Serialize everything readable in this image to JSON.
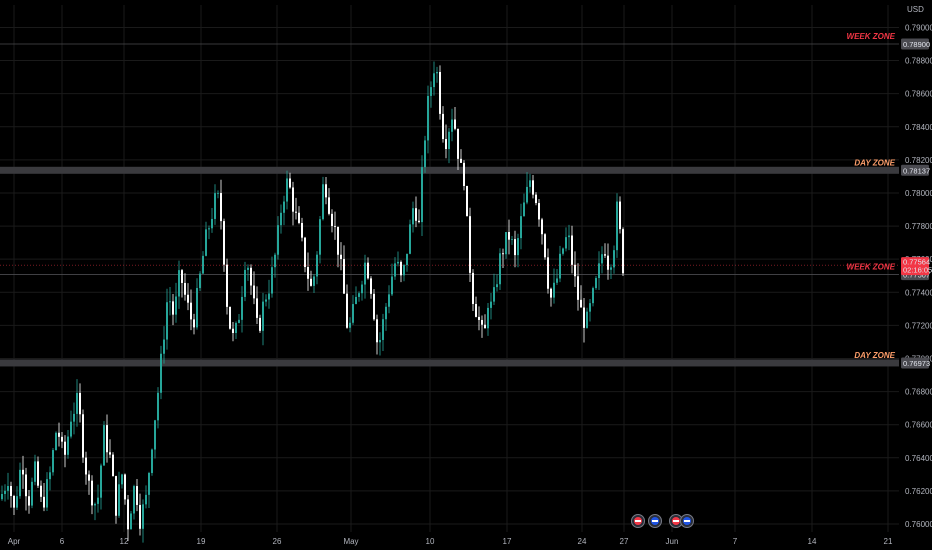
{
  "currency": "USD",
  "price_axis": {
    "ticks": [
      "0.79000",
      "0.78800",
      "0.78600",
      "0.78400",
      "0.78200",
      "0.78000",
      "0.77800",
      "0.77600",
      "0.77400",
      "0.77200",
      "0.77000",
      "0.76800",
      "0.76600",
      "0.76400",
      "0.76200",
      "0.76000"
    ]
  },
  "time_axis": {
    "ticks": [
      "Apr",
      "6",
      "12",
      "19",
      "26",
      "May",
      "10",
      "17",
      "24",
      "27",
      "Jun",
      "7",
      "14",
      "21"
    ]
  },
  "zones": [
    {
      "label": "WEEK ZONE",
      "price_label": "0.78900",
      "color": "#f23645",
      "kind": "line"
    },
    {
      "label": "DAY ZONE",
      "price_label": "0.78137",
      "color": "#ff9f6b",
      "kind": "band"
    },
    {
      "label": "WEEK ZONE",
      "price_label": "0.77507",
      "color": "#f23645",
      "kind": "line"
    },
    {
      "label": "DAY ZONE",
      "price_label": "0.76973",
      "color": "#ff9f6b",
      "kind": "band"
    }
  ],
  "last_price": {
    "value": "0.77564",
    "countdown": "02:16:05",
    "color": "#f23645"
  },
  "colors": {
    "up": "#26a69a",
    "down": "#ffffff",
    "background": "#000000",
    "grid": "#1a1a1a",
    "band": "#3a3a3e"
  },
  "chart_data": {
    "type": "candlestick",
    "timeframe": "4h",
    "ylim": [
      0.7592,
      0.7914
    ],
    "ylabel": "USD",
    "y_ticks": [
      0.79,
      0.788,
      0.786,
      0.784,
      0.782,
      0.78,
      0.778,
      0.776,
      0.774,
      0.772,
      0.77,
      0.768,
      0.766,
      0.764,
      0.762,
      0.76
    ],
    "x_ticks": [
      "Apr",
      "6",
      "12",
      "19",
      "26",
      "May",
      "10",
      "17",
      "24",
      "27",
      "Jun",
      "7",
      "14",
      "21"
    ],
    "horizontal_levels": [
      {
        "label": "WEEK ZONE",
        "value": 0.789
      },
      {
        "label": "DAY ZONE",
        "value": 0.78137
      },
      {
        "label": "WEEK ZONE",
        "value": 0.77507
      },
      {
        "label": "DAY ZONE",
        "value": 0.76973
      }
    ],
    "last_price": 0.77564,
    "close_path": [
      [
        0,
        0.7615
      ],
      [
        8,
        0.7628
      ],
      [
        14,
        0.7608
      ],
      [
        22,
        0.764
      ],
      [
        28,
        0.7612
      ],
      [
        35,
        0.7632
      ],
      [
        42,
        0.761
      ],
      [
        50,
        0.763
      ],
      [
        57,
        0.766
      ],
      [
        64,
        0.7638
      ],
      [
        71,
        0.7665
      ],
      [
        78,
        0.7675
      ],
      [
        84,
        0.764
      ],
      [
        90,
        0.762
      ],
      [
        97,
        0.761
      ],
      [
        104,
        0.7655
      ],
      [
        110,
        0.764
      ],
      [
        116,
        0.761
      ],
      [
        122,
        0.763
      ],
      [
        128,
        0.76
      ],
      [
        135,
        0.7625
      ],
      [
        140,
        0.7603
      ],
      [
        146,
        0.7615
      ],
      [
        152,
        0.765
      ],
      [
        158,
        0.768
      ],
      [
        163,
        0.771
      ],
      [
        168,
        0.774
      ],
      [
        174,
        0.7725
      ],
      [
        180,
        0.7752
      ],
      [
        186,
        0.7735
      ],
      [
        193,
        0.772
      ],
      [
        199,
        0.7745
      ],
      [
        205,
        0.777
      ],
      [
        211,
        0.7785
      ],
      [
        217,
        0.78
      ],
      [
        222,
        0.778
      ],
      [
        228,
        0.7725
      ],
      [
        234,
        0.771
      ],
      [
        240,
        0.773
      ],
      [
        246,
        0.7765
      ],
      [
        252,
        0.774
      ],
      [
        258,
        0.7715
      ],
      [
        264,
        0.7735
      ],
      [
        270,
        0.7745
      ],
      [
        276,
        0.7765
      ],
      [
        282,
        0.7795
      ],
      [
        288,
        0.7808
      ],
      [
        294,
        0.779
      ],
      [
        300,
        0.7775
      ],
      [
        306,
        0.7755
      ],
      [
        312,
        0.774
      ],
      [
        318,
        0.777
      ],
      [
        324,
        0.781
      ],
      [
        330,
        0.779
      ],
      [
        336,
        0.7775
      ],
      [
        342,
        0.775
      ],
      [
        348,
        0.7715
      ],
      [
        354,
        0.773
      ],
      [
        360,
        0.7745
      ],
      [
        366,
        0.776
      ],
      [
        372,
        0.774
      ],
      [
        378,
        0.7705
      ],
      [
        384,
        0.7725
      ],
      [
        390,
        0.7745
      ],
      [
        396,
        0.776
      ],
      [
        402,
        0.7745
      ],
      [
        408,
        0.777
      ],
      [
        414,
        0.7795
      ],
      [
        419,
        0.778
      ],
      [
        423,
        0.782
      ],
      [
        427,
        0.785
      ],
      [
        431,
        0.7865
      ],
      [
        435,
        0.788
      ],
      [
        438,
        0.7868
      ],
      [
        441,
        0.7845
      ],
      [
        445,
        0.783
      ],
      [
        449,
        0.784
      ],
      [
        453,
        0.785
      ],
      [
        457,
        0.783
      ],
      [
        460,
        0.7815
      ],
      [
        464,
        0.781
      ],
      [
        468,
        0.777
      ],
      [
        472,
        0.774
      ],
      [
        476,
        0.773
      ],
      [
        480,
        0.772
      ],
      [
        484,
        0.771
      ],
      [
        488,
        0.7735
      ],
      [
        492,
        0.773
      ],
      [
        496,
        0.7745
      ],
      [
        500,
        0.776
      ],
      [
        505,
        0.777
      ],
      [
        510,
        0.7775
      ],
      [
        515,
        0.776
      ],
      [
        520,
        0.778
      ],
      [
        525,
        0.7795
      ],
      [
        530,
        0.7808
      ],
      [
        535,
        0.78
      ],
      [
        540,
        0.7785
      ],
      [
        545,
        0.7765
      ],
      [
        550,
        0.7735
      ],
      [
        556,
        0.7745
      ],
      [
        562,
        0.7765
      ],
      [
        568,
        0.7775
      ],
      [
        574,
        0.775
      ],
      [
        580,
        0.773
      ],
      [
        586,
        0.772
      ],
      [
        592,
        0.7735
      ],
      [
        598,
        0.775
      ],
      [
        604,
        0.777
      ],
      [
        609,
        0.7755
      ],
      [
        614,
        0.777
      ],
      [
        617,
        0.779
      ],
      [
        620,
        0.7775
      ],
      [
        623,
        0.7756
      ]
    ]
  }
}
